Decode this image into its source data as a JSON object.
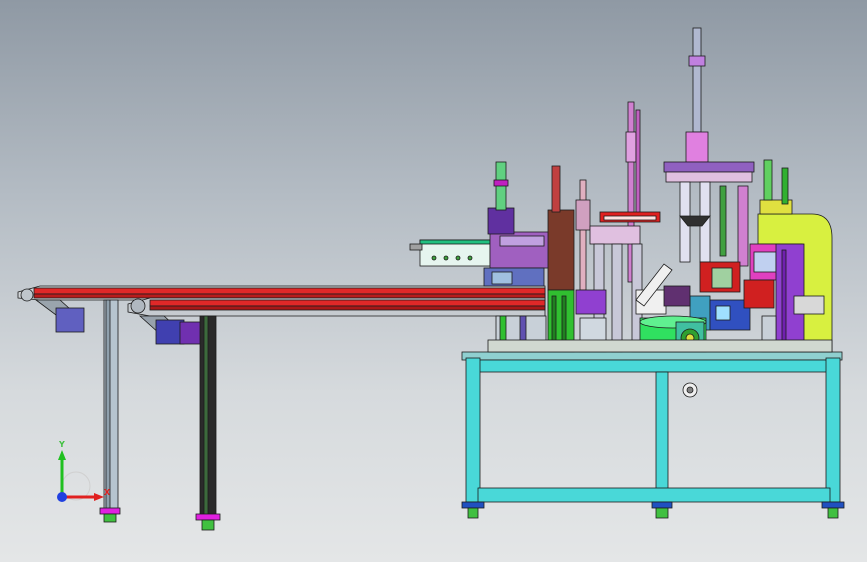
{
  "viewport": {
    "name": "cad-graphics-area",
    "background_top": "#8f99a4",
    "background_bottom": "#e4e6e7"
  },
  "triad": {
    "x_label": "X",
    "y_label": "Y",
    "x_color": "#e02020",
    "y_color": "#20c020",
    "z_color": "#2040e0"
  },
  "colors": {
    "frame": "#49d8d8",
    "outline": "#1c1c1c",
    "rail_red": "#e02828",
    "lime": "#d8f040",
    "purple": "#9040d0",
    "green": "#20d060",
    "brown": "#7a3a2a",
    "magenta": "#e020e0"
  },
  "model": {
    "parts": [
      "conveyor-left",
      "conveyor-right",
      "machine-table",
      "press-unit",
      "vertical-cylinders",
      "rotary-table"
    ]
  }
}
